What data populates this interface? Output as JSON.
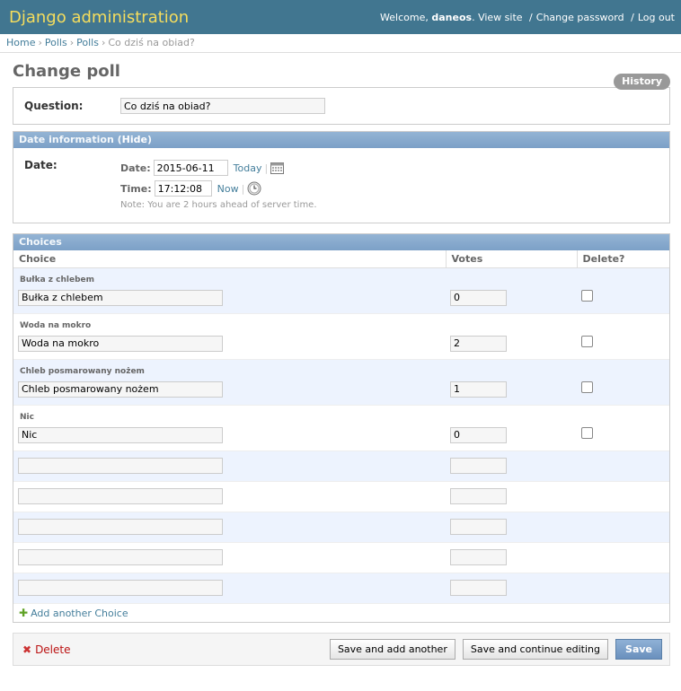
{
  "header": {
    "site_name": "Django administration",
    "welcome": "Welcome,",
    "username": "daneos",
    "view_site": "View site",
    "change_password": "Change password",
    "log_out": "Log out",
    "separator": "/"
  },
  "breadcrumbs": {
    "home": "Home",
    "app": "Polls",
    "model": "Polls",
    "current": "Co dziś na obiad?",
    "sep": "›"
  },
  "page": {
    "title": "Change poll",
    "history": "History"
  },
  "question": {
    "label": "Question:",
    "value": "Co dziś na obiad?"
  },
  "date_info": {
    "caption": "Date information",
    "toggle_open": "(",
    "toggle": "Hide",
    "toggle_close": ")",
    "label": "Date:",
    "date_label": "Date:",
    "date_value": "2015-06-11",
    "today": "Today",
    "time_label": "Time:",
    "time_value": "17:12:08",
    "now": "Now",
    "pipe": "|",
    "note": "Note: You are 2 hours ahead of server time."
  },
  "choices": {
    "caption": "Choices",
    "col_choice": "Choice",
    "col_votes": "Votes",
    "col_delete": "Delete?",
    "rows": [
      {
        "title": "Bułka z chlebem",
        "choice": "Bułka z chlebem",
        "votes": "0"
      },
      {
        "title": "Woda na mokro",
        "choice": "Woda na mokro",
        "votes": "2"
      },
      {
        "title": "Chleb posmarowany nożem",
        "choice": "Chleb posmarowany nożem",
        "votes": "1"
      },
      {
        "title": "Nic",
        "choice": "Nic",
        "votes": "0"
      }
    ],
    "add_another": "Add another Choice"
  },
  "submit": {
    "delete": "Delete",
    "save_add_another": "Save and add another",
    "save_continue": "Save and continue editing",
    "save": "Save"
  },
  "colors": {
    "header_bg": "#417690",
    "site_name": "#f5dd5d",
    "caption_bg": "#7ca0c7",
    "link": "#447e9b",
    "row_alt": "#edf3fe",
    "delete": "#bb1111"
  }
}
